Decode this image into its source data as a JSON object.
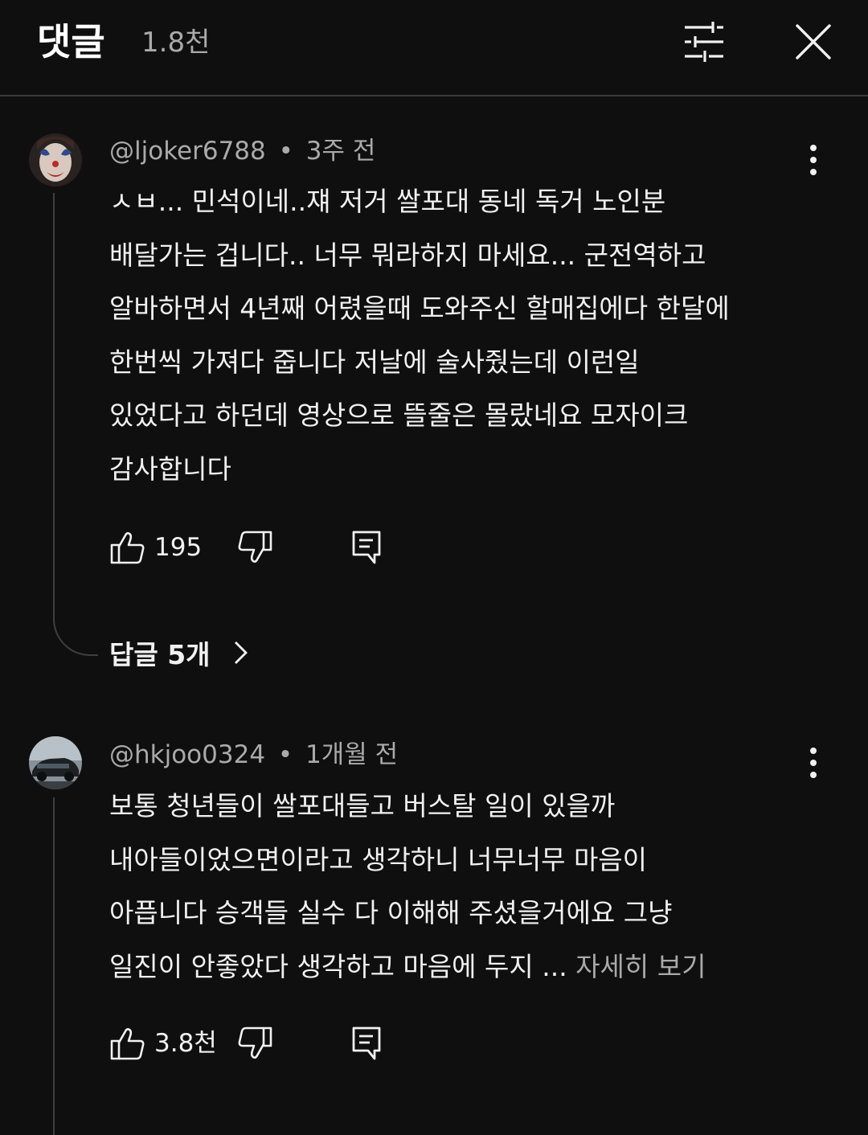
{
  "header": {
    "title": "댓글",
    "count": "1.8천"
  },
  "comments": [
    {
      "username": "@ljoker6788",
      "separator": "•",
      "time": "3주 전",
      "lines": [
        "ㅅㅂ... 민석이네..쟤 저거 쌀포대 동네 독거 노인분",
        "배달가는 겁니다.. 너무 뭐라하지 마세요... 군전역하고",
        "알바하면서 4년째 어렸을때 도와주신 할매집에다 한달에",
        "한번씩 가져다 줍니다 저날에 술사줬는데 이런일",
        "있었다고 하던데 영상으로 뜰줄은 몰랐네요 모자이크",
        "감사합니다"
      ],
      "likes": "195",
      "replies_label": "답글 5개"
    },
    {
      "username": "@hkjoo0324",
      "separator": "•",
      "time": "1개월 전",
      "lines": [
        "보통 청년들이 쌀포대들고 버스탈 일이 있을까",
        "내아들이었으면이라고 생각하니 너무너무 마음이",
        "아픕니다 승객들 실수 다 이해해 주셨을거에요 그냥",
        "일진이 안좋았다 생각하고 마음에 두지 ..."
      ],
      "read_more": "자세히 보기",
      "likes": "3.8천"
    }
  ],
  "icons": {
    "filter": "sliders-icon",
    "close": "close-icon",
    "more": "more-vertical-icon",
    "like": "thumbs-up-icon",
    "dislike": "thumbs-down-icon",
    "reply": "reply-icon",
    "chevron": "chevron-right-icon"
  },
  "colors": {
    "background": "#0f0f0f",
    "text_primary": "#f1f1f1",
    "text_secondary": "#aaaaaa",
    "divider": "#3a3a3a"
  }
}
